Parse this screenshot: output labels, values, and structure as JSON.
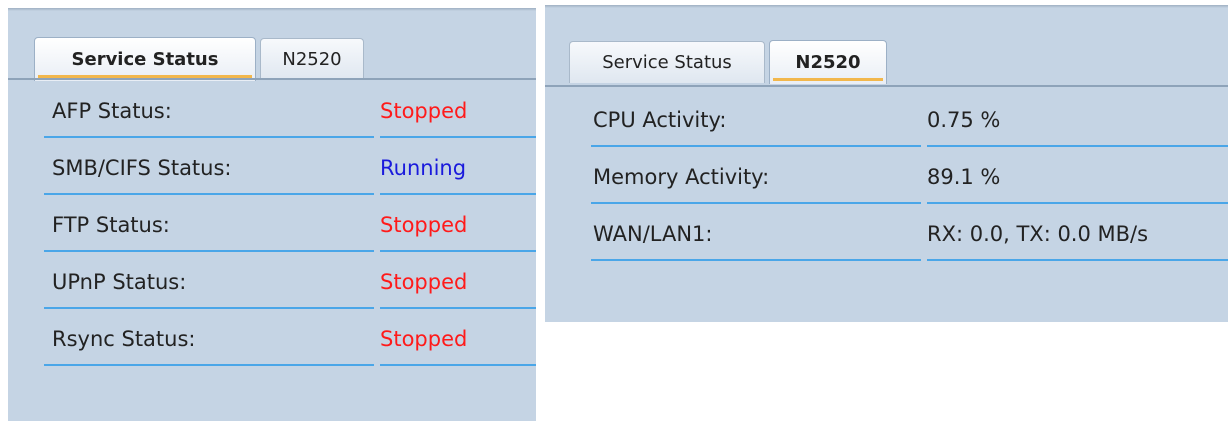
{
  "left_panel": {
    "tabs": [
      {
        "label": "Service Status",
        "active": true
      },
      {
        "label": "N2520",
        "active": false
      }
    ],
    "rows": [
      {
        "label": "AFP Status:",
        "value": "Stopped",
        "status": "stopped"
      },
      {
        "label": "SMB/CIFS Status:",
        "value": "Running",
        "status": "running"
      },
      {
        "label": "FTP Status:",
        "value": "Stopped",
        "status": "stopped"
      },
      {
        "label": "UPnP Status:",
        "value": "Stopped",
        "status": "stopped"
      },
      {
        "label": "Rsync Status:",
        "value": "Stopped",
        "status": "stopped"
      }
    ]
  },
  "right_panel": {
    "tabs": [
      {
        "label": "Service Status",
        "active": false
      },
      {
        "label": "N2520",
        "active": true
      }
    ],
    "rows": [
      {
        "label": "CPU Activity:",
        "value": "0.75 %"
      },
      {
        "label": "Memory Activity:",
        "value": "89.1 %"
      },
      {
        "label": "WAN/LAN1:",
        "value": "RX: 0.0, TX: 0.0 MB/s"
      }
    ]
  },
  "colors": {
    "panel_bg": "#c5d4e4",
    "divider": "#4aa6e8",
    "stopped": "#ff1a1a",
    "running": "#1a1adc",
    "active_tab_accent": "#f2b74c"
  }
}
